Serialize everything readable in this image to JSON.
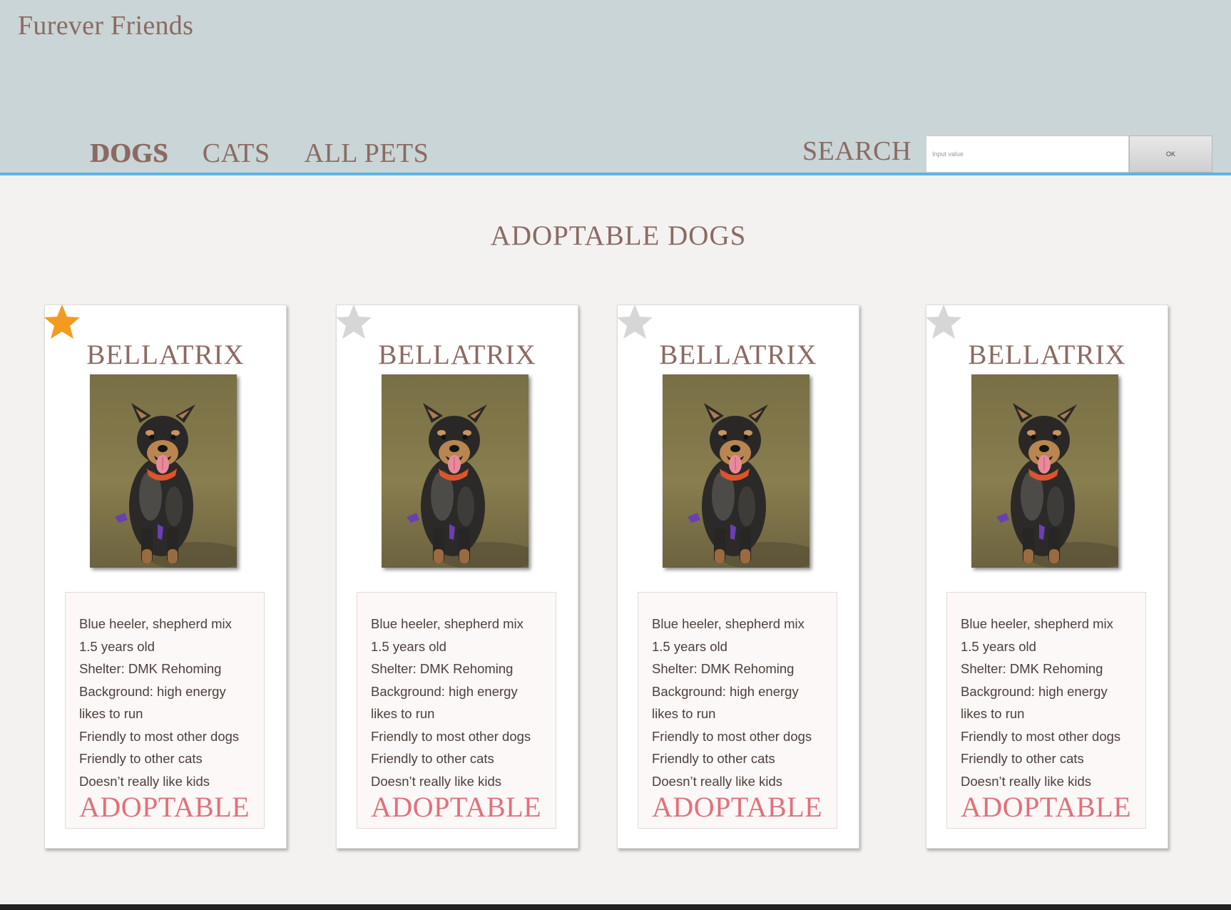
{
  "header": {
    "brand": "Furever Friends",
    "nav": [
      "DOGS",
      "CATS",
      "ALL PETS"
    ],
    "search_label": "SEARCH",
    "search_placeholder": "Input value",
    "ok_label": "OK",
    "accent_color": "#5bb5e6",
    "background_color": "#c9d5d6"
  },
  "main": {
    "title": "ADOPTABLE DOGS",
    "cards": [
      {
        "name": "BELLATRIX",
        "favorited": true,
        "star_icon": "star-icon",
        "photo_icon": "dog-photo",
        "details": [
          "Blue heeler, shepherd mix",
          "1.5 years old",
          "Shelter: DMK Rehoming",
          "Background: high energy",
          "likes to run",
          "Friendly to most other dogs",
          "Friendly to other cats",
          "Doesn’t really like kids"
        ],
        "status": "ADOPTABLE"
      },
      {
        "name": "BELLATRIX",
        "favorited": false,
        "star_icon": "star-icon",
        "photo_icon": "dog-photo",
        "details": [
          "Blue heeler, shepherd mix",
          "1.5 years old",
          "Shelter: DMK Rehoming",
          "Background: high energy",
          "likes to run",
          "Friendly to most other dogs",
          "Friendly to other cats",
          "Doesn’t really like kids"
        ],
        "status": "ADOPTABLE"
      },
      {
        "name": "BELLATRIX",
        "favorited": false,
        "star_icon": "star-icon",
        "photo_icon": "dog-photo",
        "details": [
          "Blue heeler, shepherd mix",
          "1.5 years old",
          "Shelter: DMK Rehoming",
          "Background: high energy",
          "likes to run",
          "Friendly to most other dogs",
          "Friendly to other cats",
          "Doesn’t really like kids"
        ],
        "status": "ADOPTABLE"
      },
      {
        "name": "BELLATRIX",
        "favorited": false,
        "star_icon": "star-icon",
        "photo_icon": "dog-photo",
        "details": [
          "Blue heeler, shepherd mix",
          "1.5 years old",
          "Shelter: DMK Rehoming",
          "Background: high energy",
          "likes to run",
          "Friendly to most other dogs",
          "Friendly to other cats",
          "Doesn’t really like kids"
        ],
        "status": "ADOPTABLE"
      }
    ]
  },
  "colors": {
    "text_primary": "#8b6a62",
    "status_color": "#e2707a",
    "star_active": "#f29b1f",
    "star_inactive": "#d6d6d6"
  }
}
